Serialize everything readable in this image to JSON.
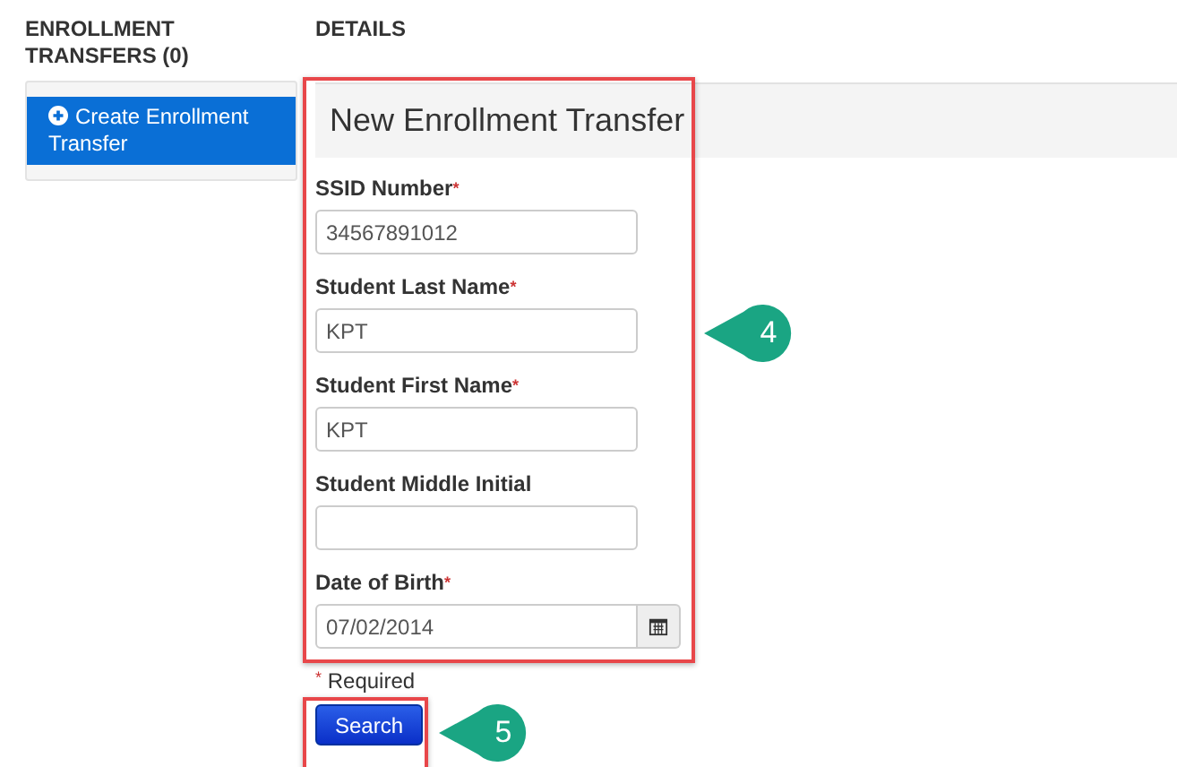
{
  "sidebar": {
    "title": "ENROLLMENT TRANSFERS (0)",
    "items": [
      {
        "label": "Create Enrollment Transfer",
        "selected": true
      }
    ]
  },
  "details": {
    "title": "DETAILS",
    "panel_title": "New Enrollment Transfer",
    "fields": [
      {
        "kind": "text",
        "label": "SSID Number",
        "required": true,
        "value": "34567891012"
      },
      {
        "kind": "text",
        "label": "Student Last Name",
        "required": true,
        "value": "KPT"
      },
      {
        "kind": "text",
        "label": "Student First Name",
        "required": true,
        "value": "KPT"
      },
      {
        "kind": "text",
        "label": "Student Middle Initial",
        "required": false
      },
      {
        "kind": "date",
        "label": "Date of Birth",
        "required": true,
        "value": "07/02/2014"
      }
    ],
    "required_note": {
      "mark": "*",
      "text": "Required"
    },
    "search_button": "Search"
  },
  "callouts": [
    "4",
    "5"
  ]
}
